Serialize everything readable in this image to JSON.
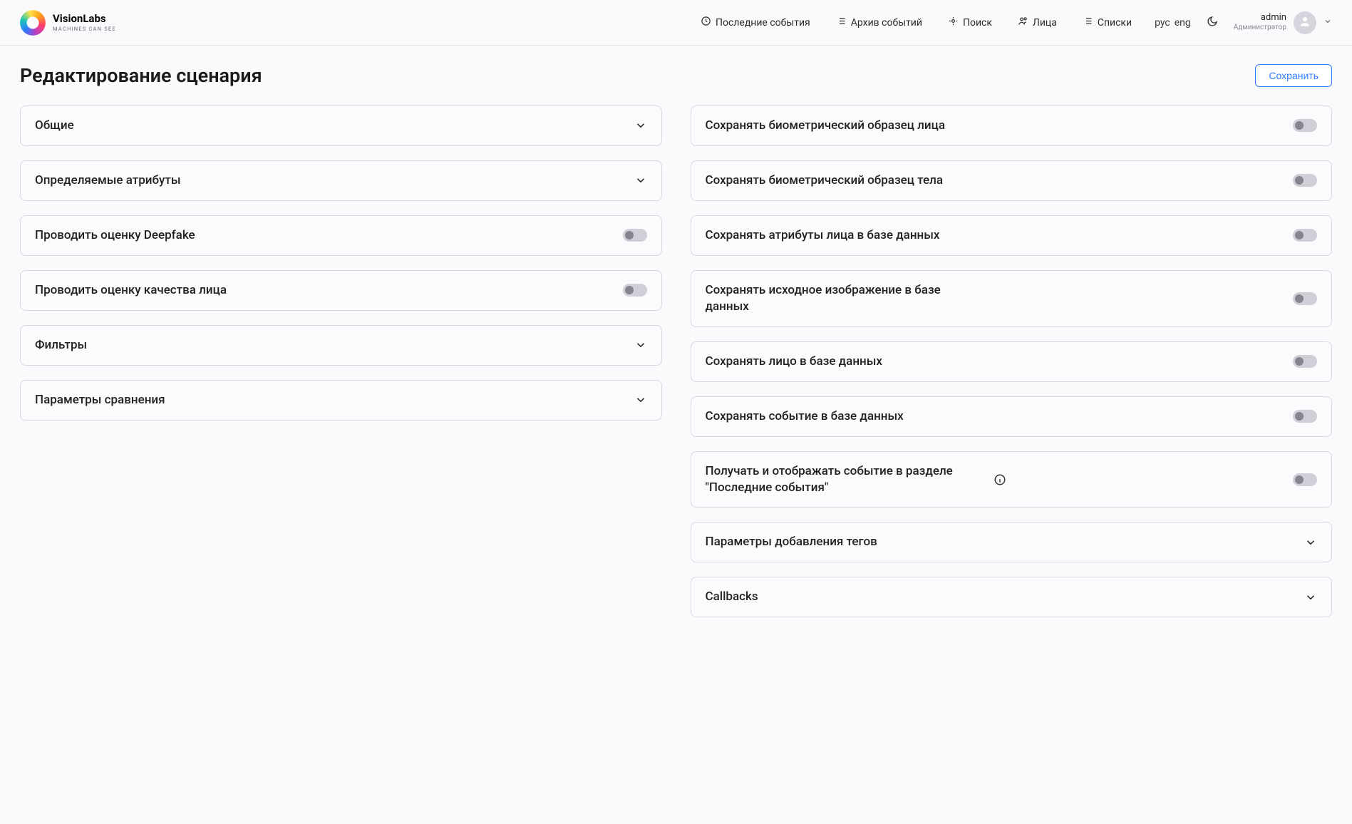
{
  "brand": {
    "title": "VisionLabs",
    "tagline": "MACHINES CAN SEE"
  },
  "nav": {
    "recent": "Последние события",
    "archive": "Архив событий",
    "search": "Поиск",
    "faces": "Лица",
    "lists": "Списки"
  },
  "lang": {
    "ru": "рус",
    "en": "eng"
  },
  "user": {
    "name": "admin",
    "role": "Администратор"
  },
  "page": {
    "title": "Редактирование сценария",
    "save": "Сохранить"
  },
  "left": {
    "general": "Общие",
    "attributes": "Определяемые атрибуты",
    "deepfake": "Проводить оценку Deepfake",
    "face_quality": "Проводить оценку качества лица",
    "filters": "Фильтры",
    "compare_params": "Параметры сравнения"
  },
  "right": {
    "save_face_bio": "Сохранять биометрический образец лица",
    "save_body_bio": "Сохранять биометрический образец тела",
    "save_face_attrs_db": "Сохранять атрибуты лица в базе данных",
    "save_source_db": "Сохранять исходное изображение в базе данных",
    "save_face_db": "Сохранять лицо в базе данных",
    "save_event_db": "Сохранять событие в базе данных",
    "show_recent": "Получать и отображать событие в разделе \"Последние события\"",
    "tag_params": "Параметры добавления тегов",
    "callbacks": "Callbacks"
  }
}
